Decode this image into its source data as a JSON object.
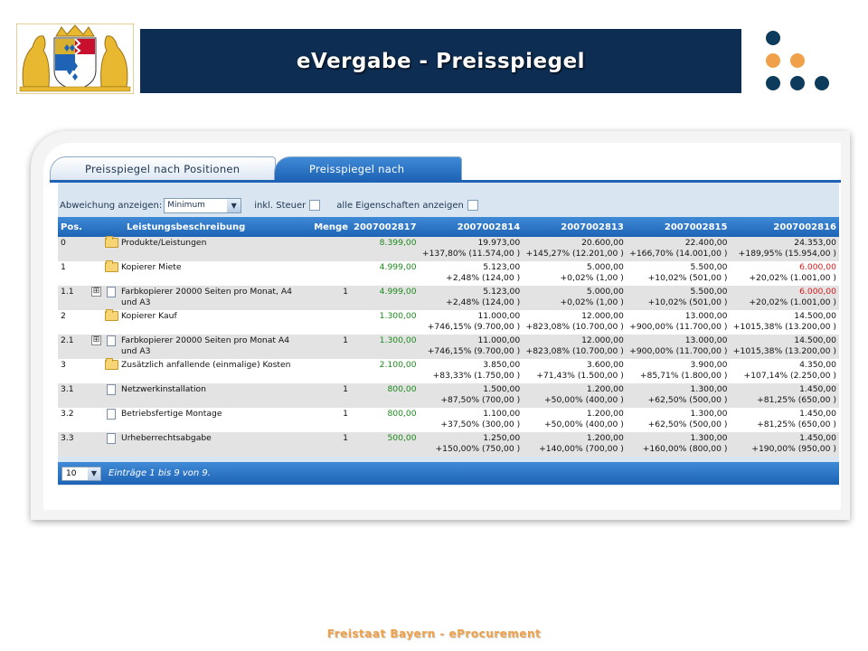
{
  "slide": {
    "title": "eVergabe - Preisspiegel",
    "footer": "Freistaat Bayern - eProcurement",
    "brand_dark": "#0d2d52",
    "brand_orange": "#f0a048",
    "dot_colors": [
      "#0d3b5c",
      "#f0a048"
    ]
  },
  "tabs": [
    {
      "label": "Preisspiegel nach Positionen",
      "active": false
    },
    {
      "label": "Preisspiegel nach Losen",
      "active": true
    }
  ],
  "filter": {
    "deviation_label": "Abweichung anzeigen:",
    "deviation_value": "Minimum",
    "tax_label": "inkl. Steuer",
    "all_props_label": "alle Eigenschaften anzeigen"
  },
  "table": {
    "headers": [
      "Pos.",
      "Leistungsbeschreibung",
      "Menge",
      "2007002817",
      "2007002814",
      "2007002813",
      "2007002815",
      "2007002816"
    ],
    "rows": [
      {
        "pos": "0",
        "type": "folder",
        "expand": "",
        "desc": [
          "Produkte/Leistungen"
        ],
        "menge": "",
        "base": "8.399,00",
        "vals": [
          [
            "19.973,00",
            "+137,80% (11.574,00 )"
          ],
          [
            "20.600,00",
            "+145,27% (12.201,00 )"
          ],
          [
            "22.400,00",
            "+166,70% (14.001,00 )"
          ],
          [
            "24.353,00",
            "+189,95% (15.954,00 )"
          ]
        ],
        "red_last": false
      },
      {
        "pos": "1",
        "type": "folder",
        "expand": "",
        "desc": [
          "Kopierer Miete"
        ],
        "menge": "",
        "base": "4.999,00",
        "vals": [
          [
            "5.123,00",
            "+2,48% (124,00 )"
          ],
          [
            "5.000,00",
            "+0,02% (1,00 )"
          ],
          [
            "5.500,00",
            "+10,02% (501,00 )"
          ],
          [
            "6.000,00",
            "+20,02% (1.001,00 )"
          ]
        ],
        "red_last": true
      },
      {
        "pos": "1.1",
        "type": "doc",
        "expand": "⊞",
        "desc": [
          "Farbkopierer 20000 Seiten pro Monat, A4",
          "und A3"
        ],
        "menge": "1",
        "base": "4.999,00",
        "vals": [
          [
            "5.123,00",
            "+2,48% (124,00 )"
          ],
          [
            "5.000,00",
            "+0,02% (1,00 )"
          ],
          [
            "5.500,00",
            "+10,02% (501,00 )"
          ],
          [
            "6.000,00",
            "+20,02% (1.001,00 )"
          ]
        ],
        "red_last": true
      },
      {
        "pos": "2",
        "type": "folder",
        "expand": "",
        "desc": [
          "Kopierer Kauf"
        ],
        "menge": "",
        "base": "1.300,00",
        "vals": [
          [
            "11.000,00",
            "+746,15% (9.700,00 )"
          ],
          [
            "12.000,00",
            "+823,08% (10.700,00 )"
          ],
          [
            "13.000,00",
            "+900,00% (11.700,00 )"
          ],
          [
            "14.500,00",
            "+1015,38% (13.200,00 )"
          ]
        ],
        "red_last": false
      },
      {
        "pos": "2.1",
        "type": "doc",
        "expand": "⊞",
        "desc": [
          "Farbkopierer 20000 Seiten pro Monat A4",
          "und A3"
        ],
        "menge": "1",
        "base": "1.300,00",
        "vals": [
          [
            "11.000,00",
            "+746,15% (9.700,00 )"
          ],
          [
            "12.000,00",
            "+823,08% (10.700,00 )"
          ],
          [
            "13.000,00",
            "+900,00% (11.700,00 )"
          ],
          [
            "14.500,00",
            "+1015,38% (13.200,00 )"
          ]
        ],
        "red_last": false
      },
      {
        "pos": "3",
        "type": "folder",
        "expand": "",
        "desc": [
          "Zusätzlich anfallende (einmalige) Kosten"
        ],
        "menge": "",
        "base": "2.100,00",
        "vals": [
          [
            "3.850,00",
            "+83,33% (1.750,00 )"
          ],
          [
            "3.600,00",
            "+71,43% (1.500,00 )"
          ],
          [
            "3.900,00",
            "+85,71% (1.800,00 )"
          ],
          [
            "4.350,00",
            "+107,14% (2.250,00 )"
          ]
        ],
        "red_last": false
      },
      {
        "pos": "3.1",
        "type": "doc",
        "expand": "",
        "desc": [
          "Netzwerkinstallation"
        ],
        "menge": "1",
        "base": "800,00",
        "vals": [
          [
            "1.500,00",
            "+87,50% (700,00 )"
          ],
          [
            "1.200,00",
            "+50,00% (400,00 )"
          ],
          [
            "1.300,00",
            "+62,50% (500,00 )"
          ],
          [
            "1.450,00",
            "+81,25% (650,00 )"
          ]
        ],
        "red_last": false
      },
      {
        "pos": "3.2",
        "type": "doc",
        "expand": "",
        "desc": [
          "Betriebsfertige Montage"
        ],
        "menge": "1",
        "base": "800,00",
        "vals": [
          [
            "1.100,00",
            "+37,50% (300,00 )"
          ],
          [
            "1.200,00",
            "+50,00% (400,00 )"
          ],
          [
            "1.300,00",
            "+62,50% (500,00 )"
          ],
          [
            "1.450,00",
            "+81,25% (650,00 )"
          ]
        ],
        "red_last": false
      },
      {
        "pos": "3.3",
        "type": "doc",
        "expand": "",
        "desc": [
          "Urheberrechtsabgabe"
        ],
        "menge": "1",
        "base": "500,00",
        "vals": [
          [
            "1.250,00",
            "+150,00% (750,00 )"
          ],
          [
            "1.200,00",
            "+140,00% (700,00 )"
          ],
          [
            "1.300,00",
            "+160,00% (800,00 )"
          ],
          [
            "1.450,00",
            "+190,00% (950,00 )"
          ]
        ],
        "red_last": false
      }
    ]
  },
  "pager": {
    "page_size": "10",
    "summary": "Einträge 1 bis 9 von 9."
  }
}
